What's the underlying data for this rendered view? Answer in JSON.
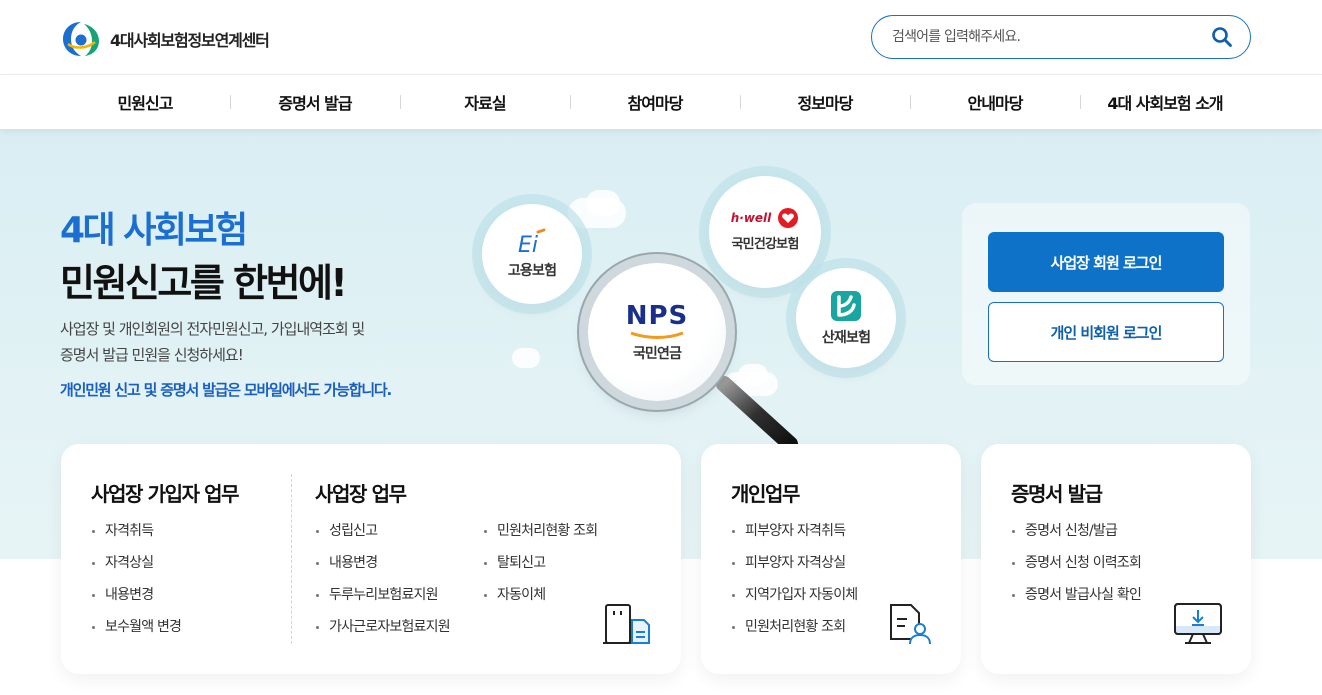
{
  "header": {
    "logo_text": "4대사회보험정보연계센터",
    "search_placeholder": "검색어를 입력해주세요."
  },
  "nav": {
    "items": [
      "민원신고",
      "증명서 발급",
      "자료실",
      "참여마당",
      "정보마당",
      "안내마당",
      "4대 사회보험 소개"
    ]
  },
  "hero": {
    "title_line1": "4대 사회보험",
    "title_line2": "민원신고를 한번에!",
    "desc_line1": "사업장 및 개인회원의 전자민원신고, 가입내역조회 및",
    "desc_line2": "증명서 발급 민원을 신청하세요!",
    "mobile_note": "개인민원 신고 및 증명서 발급은 모바일에서도 가능합니다."
  },
  "insurances": {
    "employment": {
      "label": "고용보험",
      "logo_text": "Ei"
    },
    "health": {
      "label": "국민건강보험",
      "logo_text": "h·well"
    },
    "pension": {
      "label": "국민연금",
      "logo_text": "NPS"
    },
    "industrial": {
      "label": "산재보험"
    }
  },
  "login": {
    "business_label": "사업장 회원 로그인",
    "personal_label": "개인 비회원 로그인"
  },
  "cards": {
    "subscriber": {
      "title": "사업장 가입자 업무",
      "items": [
        "자격취득",
        "자격상실",
        "내용변경",
        "보수월액 변경"
      ]
    },
    "workplace": {
      "title": "사업장 업무",
      "col1": [
        "성립신고",
        "내용변경",
        "두루누리보험료지원",
        "가사근로자보험료지원"
      ],
      "col2": [
        "민원처리현황 조회",
        "탈퇴신고",
        "자동이체"
      ]
    },
    "personal": {
      "title": "개인업무",
      "items": [
        "피부양자 자격취득",
        "피부양자 자격상실",
        "지역가입자 자동이체",
        "민원처리현황 조회"
      ]
    },
    "certificate": {
      "title": "증명서 발급",
      "items": [
        "증명서 신청/발급",
        "증명서 신청 이력조회",
        "증명서 발급사실 확인"
      ]
    }
  },
  "colors": {
    "primary": "#0f72c9",
    "accent_text": "#1a6fd0",
    "hero_bg": "#dcf0f4"
  }
}
